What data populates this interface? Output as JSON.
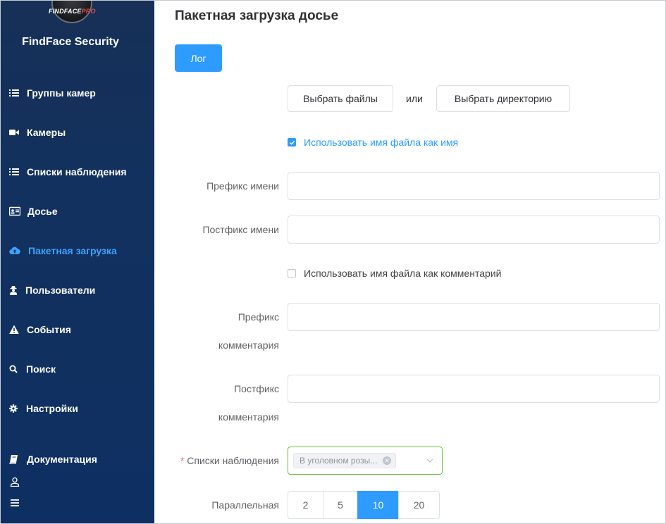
{
  "app": {
    "logo_main": "FINDFACE",
    "logo_pro": "PRO",
    "title": "FindFace Security"
  },
  "sidebar": {
    "items": [
      {
        "label": "Группы камер",
        "icon": "list-icon"
      },
      {
        "label": "Камеры",
        "icon": "video-camera-icon"
      },
      {
        "label": "Списки наблюдения",
        "icon": "list-icon"
      },
      {
        "label": "Досье",
        "icon": "id-card-icon"
      },
      {
        "label": "Пакетная загрузка",
        "icon": "cloud-upload-icon",
        "active": true
      },
      {
        "label": "Пользователи",
        "icon": "user-secret-icon"
      },
      {
        "label": "События",
        "icon": "warning-icon"
      },
      {
        "label": "Поиск",
        "icon": "search-icon"
      },
      {
        "label": "Настройки",
        "icon": "gear-icon"
      },
      {
        "label": "Документация",
        "icon": "book-icon"
      }
    ],
    "bottom_icons": [
      "user-icon",
      "menu-icon"
    ]
  },
  "page": {
    "title": "Пакетная загрузка досье",
    "log_button": "Лог",
    "choose_files": "Выбрать файлы",
    "or": "или",
    "choose_directory": "Выбрать директорию",
    "use_filename_as_name": {
      "label": "Использовать имя файла как имя",
      "checked": true
    },
    "name_prefix": {
      "label": "Префикс имени",
      "value": ""
    },
    "name_postfix": {
      "label": "Постфикс имени",
      "value": ""
    },
    "use_filename_as_comment": {
      "label": "Использовать имя файла как комментарий",
      "checked": false
    },
    "comment_prefix": {
      "label_line1": "Префикс",
      "label_line2": "комментария",
      "value": ""
    },
    "comment_postfix": {
      "label_line1": "Постфикс",
      "label_line2": "комментария",
      "value": ""
    },
    "watch_lists": {
      "label": "Списки наблюдения",
      "required_mark": "*",
      "selected_tag": "В уголовном розы..."
    },
    "parallel": {
      "label": "Параллельная",
      "options": [
        "2",
        "5",
        "10",
        "20"
      ],
      "selected": "10"
    }
  },
  "colors": {
    "accent": "#2d9bff",
    "sidebar_bg": "#12315f",
    "select_border": "#67c23a",
    "required": "#f56c6c"
  }
}
